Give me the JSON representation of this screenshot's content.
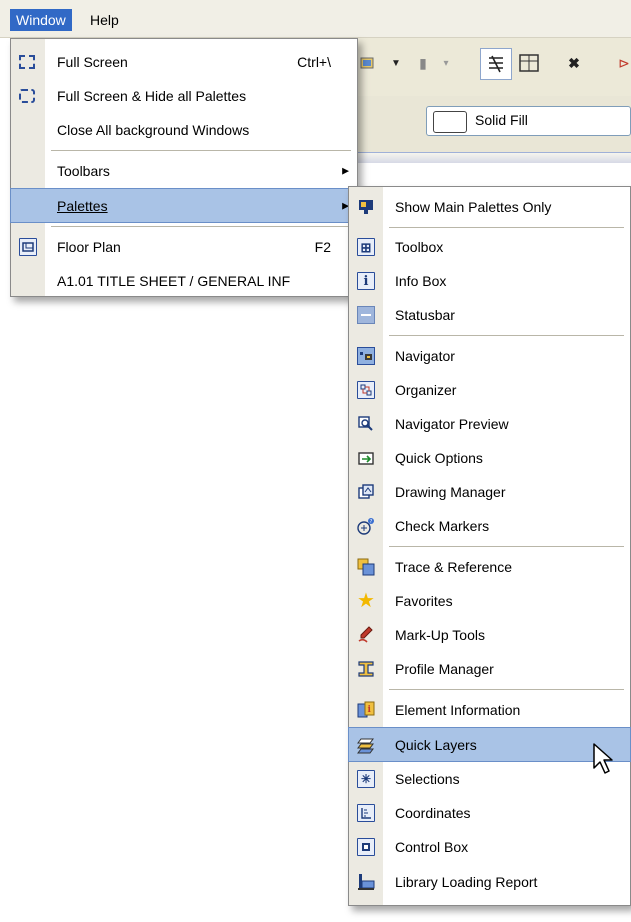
{
  "menubar": {
    "items": [
      {
        "label": "Window"
      },
      {
        "label": "Help"
      }
    ]
  },
  "toolbar": {
    "fill_label": "Solid Fill"
  },
  "window_menu": {
    "items": [
      {
        "label": "Full Screen",
        "shortcut": "Ctrl+\\",
        "icon": "full-screen-icon"
      },
      {
        "label": "Full Screen & Hide all Palettes",
        "icon": "full-screen-hide-icon"
      },
      {
        "label": "Close All background Windows"
      },
      {
        "label": "Toolbars",
        "submenu": true
      },
      {
        "label": "Palettes",
        "submenu": true,
        "selected": true
      },
      {
        "label": "Floor Plan",
        "shortcut": "F2",
        "icon": "floor-plan-icon"
      },
      {
        "label": "A1.01 TITLE SHEET / GENERAL INF"
      }
    ]
  },
  "palettes_menu": {
    "items": [
      {
        "label": "Show Main Palettes Only",
        "icon": "main-palettes-icon"
      },
      {
        "label": "Toolbox",
        "icon": "toolbox-icon"
      },
      {
        "label": "Info Box",
        "icon": "info-box-icon"
      },
      {
        "label": "Statusbar",
        "icon": "statusbar-icon"
      },
      {
        "label": "Navigator",
        "icon": "navigator-icon"
      },
      {
        "label": "Organizer",
        "icon": "organizer-icon"
      },
      {
        "label": "Navigator Preview",
        "icon": "navigator-preview-icon"
      },
      {
        "label": "Quick Options",
        "icon": "quick-options-icon"
      },
      {
        "label": "Drawing Manager",
        "icon": "drawing-manager-icon"
      },
      {
        "label": "Check Markers",
        "icon": "check-markers-icon"
      },
      {
        "label": "Trace & Reference",
        "icon": "trace-reference-icon"
      },
      {
        "label": "Favorites",
        "icon": "favorites-star-icon"
      },
      {
        "label": "Mark-Up Tools",
        "icon": "markup-tools-icon"
      },
      {
        "label": "Profile Manager",
        "icon": "profile-manager-icon"
      },
      {
        "label": "Element Information",
        "icon": "element-information-icon"
      },
      {
        "label": "Quick Layers",
        "icon": "quick-layers-icon",
        "selected": true
      },
      {
        "label": "Selections",
        "icon": "selections-icon"
      },
      {
        "label": "Coordinates",
        "icon": "coordinates-icon"
      },
      {
        "label": "Control Box",
        "icon": "control-box-icon"
      },
      {
        "label": "Library Loading Report",
        "icon": "library-loading-report-icon"
      }
    ]
  },
  "colors": {
    "menubar_selected": "#3169c6",
    "item_highlight": "#a9c3e6",
    "icon_blue": "#2a4d9a"
  }
}
